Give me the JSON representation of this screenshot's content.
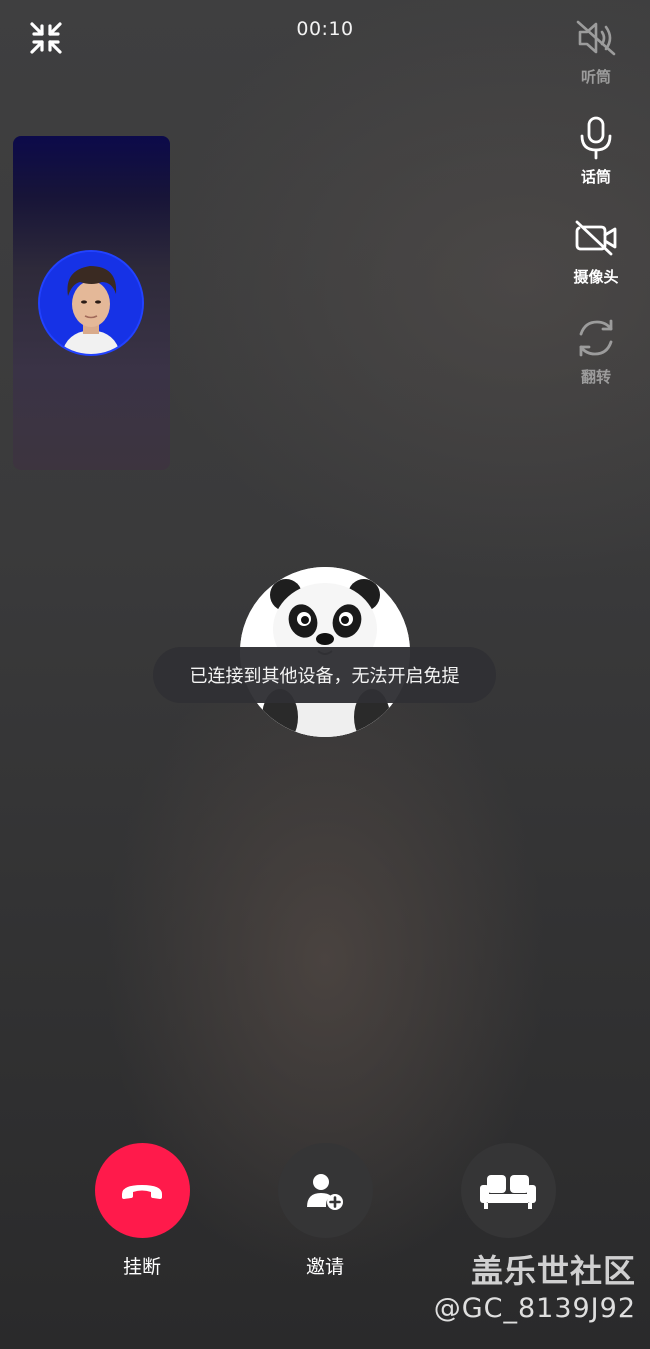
{
  "call": {
    "timer": "00:10",
    "minimize_icon": "minimize-arrows-icon"
  },
  "side_controls": [
    {
      "label": "听筒",
      "icon": "speaker-muted-icon",
      "state": "disabled"
    },
    {
      "label": "话筒",
      "icon": "microphone-icon",
      "state": "active"
    },
    {
      "label": "摄像头",
      "icon": "camera-off-icon",
      "state": "active"
    },
    {
      "label": "翻转",
      "icon": "flip-camera-icon",
      "state": "disabled"
    }
  ],
  "toast": {
    "message": "已连接到其他设备，无法开启免提"
  },
  "bottom_controls": {
    "hangup_label": "挂断",
    "invite_label": "邀请",
    "third_label": "",
    "hangup_color": "#FF1A4B"
  },
  "watermark": {
    "line1": "盖乐世社区",
    "line2": "@GC_8139J92"
  }
}
